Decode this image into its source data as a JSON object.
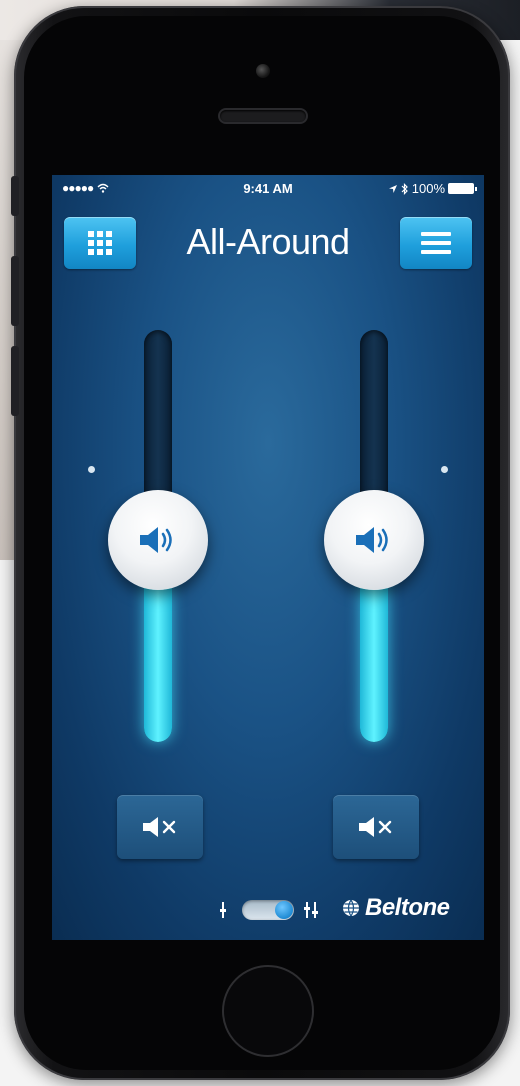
{
  "status_bar": {
    "signal": "●●●●●",
    "wifi_icon": "wifi-icon",
    "time": "9:41 AM",
    "location_icon": "location-arrow-icon",
    "bluetooth_icon": "bluetooth-icon",
    "battery_percent": "100%"
  },
  "nav": {
    "title": "All-Around",
    "left_button_icon": "grid-icon",
    "right_button_icon": "menu-icon"
  },
  "volume": {
    "left": {
      "level": 0.5,
      "icon": "speaker-icon"
    },
    "right": {
      "level": 0.5,
      "icon": "speaker-icon"
    }
  },
  "mute_buttons": {
    "left_icon": "mute-icon",
    "right_icon": "mute-icon"
  },
  "footer": {
    "toggle_state": "on",
    "brand": "Beltone"
  },
  "colors": {
    "screen_background": "#1a5285",
    "accent_button": "#1f9fdc",
    "slider_fill": "#5ff2ff",
    "text": "#ffffff"
  }
}
